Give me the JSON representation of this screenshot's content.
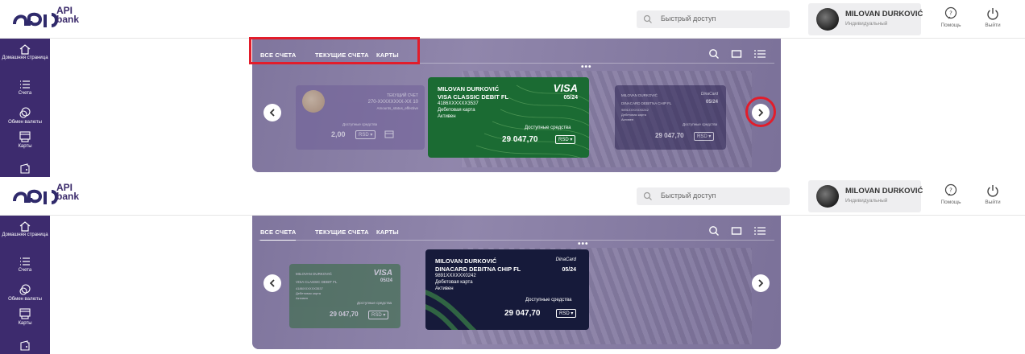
{
  "app": {
    "logo_line1": "API",
    "logo_line2": "bank",
    "search_placeholder": "Быстрый доступ",
    "user_name": "MILOVAN DURKOVIĆ",
    "user_role": "Индивидуальный",
    "help_label": "Помощь",
    "logout_label": "Выйти",
    "accent": "#3d2b6e",
    "highlight": "#e21d2b"
  },
  "sidebar": {
    "items": [
      {
        "label": "Домашняя страница",
        "icon": "home-icon"
      },
      {
        "label": "Счета",
        "icon": "list-icon"
      },
      {
        "label": "Обмен валюты",
        "icon": "exchange-icon"
      },
      {
        "label": "Карты",
        "icon": "card-icon"
      },
      {
        "label": "",
        "icon": "wallet-icon"
      }
    ]
  },
  "tabs": [
    {
      "label": "ВСЕ СЧЕТА"
    },
    {
      "label": "ТЕКУЩИЕ СЧЕТА"
    },
    {
      "label": "КАРТЫ"
    }
  ],
  "frames": [
    {
      "left_card": {
        "type_label": "ТЕКУЩИЙ СЧЕТ",
        "number": "270-XXXXXXXX-XX 10",
        "sub": "Amounts_status_effective",
        "balance_label": "Доступные средства",
        "amount": "2,00",
        "currency": "RSD"
      },
      "center_card": {
        "holder": "MILOVAN DURKOVIĆ",
        "product": "VISA CLASSIC DEBIT FL",
        "number": "4186XXXXXX3537",
        "kind": "Дебетовая карта",
        "status": "Активен",
        "brand": "VISA",
        "expiry": "05/24",
        "balance_label": "Доступные средства",
        "amount": "29 047,70",
        "currency": "RSD"
      },
      "right_card": {
        "holder": "MILOVAN DURKOVIĆ",
        "product": "DINACARD DEBITNA CHIP FL",
        "number": "9891XXXXXX0242",
        "kind": "Дебетовая карта",
        "status": "Активен",
        "brand": "DinaCard",
        "expiry": "05/24",
        "balance_label": "Доступные средства",
        "amount": "29 047,70",
        "currency": "RSD"
      }
    },
    {
      "left_card": {
        "holder": "MILOVAN DURKOVIĆ",
        "product": "VISA CLASSIC DEBIT FL",
        "number": "4186XXXXXX3537",
        "kind": "Дебетовая карта",
        "status": "Активен",
        "brand": "VISA",
        "expiry": "05/24",
        "balance_label": "Доступные средства",
        "amount": "29 047,70",
        "currency": "RSD"
      },
      "center_card": {
        "holder": "MILOVAN DURKOVIĆ",
        "product": "DINACARD DEBITNA CHIP FL",
        "number": "9891XXXXXX0242",
        "kind": "Дебетовая карта",
        "status": "Активен",
        "brand": "DinaCard",
        "expiry": "05/24",
        "balance_label": "Доступные средства",
        "amount": "29 047,70",
        "currency": "RSD"
      }
    }
  ]
}
